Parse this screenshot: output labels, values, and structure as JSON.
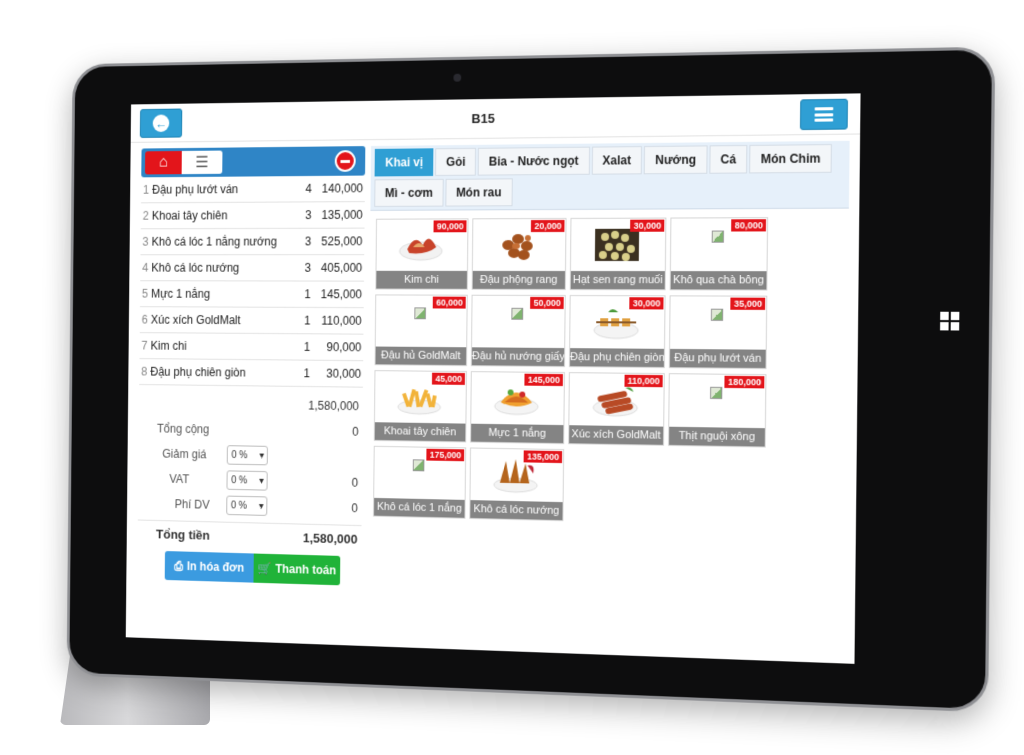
{
  "header": {
    "title": "B15"
  },
  "order": {
    "rows": [
      {
        "idx": "1",
        "name": "Đậu phụ lướt ván",
        "qty": "4",
        "price": "140,000"
      },
      {
        "idx": "2",
        "name": "Khoai tây chiên",
        "qty": "3",
        "price": "135,000"
      },
      {
        "idx": "3",
        "name": "Khô cá lóc 1 nắng nướng",
        "qty": "3",
        "price": "525,000"
      },
      {
        "idx": "4",
        "name": "Khô cá lóc nướng",
        "qty": "3",
        "price": "405,000"
      },
      {
        "idx": "5",
        "name": "Mực 1 nắng",
        "qty": "1",
        "price": "145,000"
      },
      {
        "idx": "6",
        "name": "Xúc xích GoldMalt",
        "qty": "1",
        "price": "110,000"
      },
      {
        "idx": "7",
        "name": "Kim chi",
        "qty": "1",
        "price": "90,000"
      },
      {
        "idx": "8",
        "name": "Đậu phụ chiên giòn",
        "qty": "1",
        "price": "30,000"
      }
    ],
    "subtotal": "1,580,000",
    "tong_cong_label": "Tổng cộng",
    "tong_cong_value": "0",
    "giam_gia_label": "Giảm giá",
    "giam_gia_select": "0 %",
    "vat_label": "VAT",
    "vat_select": "0 %",
    "vat_value": "0",
    "phi_dv_label": "Phí DV",
    "phi_dv_select": "0 %",
    "phi_dv_value": "0",
    "total_label": "Tổng tiền",
    "total_value": "1,580,000",
    "print_label": "In hóa đơn",
    "pay_label": "Thanh toán"
  },
  "menu": {
    "tabs_row1": [
      "Khai vị",
      "Gỏi",
      "Bia - Nước ngọt",
      "Xalat",
      "Nướng",
      "Cá",
      "Món Chim"
    ],
    "tabs_row2": [
      "Mì - cơm",
      "Món rau"
    ],
    "active_tab": "Khai vị",
    "items": [
      {
        "name": "Kim chi",
        "price": "90,000",
        "image": "kimchi"
      },
      {
        "name": "Đậu phộng rang",
        "price": "20,000",
        "image": "peanuts"
      },
      {
        "name": "Hạt sen rang muối",
        "price": "30,000",
        "image": "lotus-seeds"
      },
      {
        "name": "Khô qua chà bông",
        "price": "80,000",
        "image": "broken"
      },
      {
        "name": "Đậu hủ GoldMalt",
        "price": "60,000",
        "image": "broken"
      },
      {
        "name": "Đậu hủ nướng giấy",
        "price": "50,000",
        "image": "broken"
      },
      {
        "name": "Đậu phụ chiên giòn",
        "price": "30,000",
        "image": "skewers"
      },
      {
        "name": "Đậu phụ lướt ván",
        "price": "35,000",
        "image": "broken"
      },
      {
        "name": "Khoai tây chiên",
        "price": "45,000",
        "image": "fries"
      },
      {
        "name": "Mực 1 nắng",
        "price": "145,000",
        "image": "squid"
      },
      {
        "name": "Xúc xích GoldMalt",
        "price": "110,000",
        "image": "sausage"
      },
      {
        "name": "Thịt nguội xông",
        "price": "180,000",
        "image": "broken"
      },
      {
        "name": "Khô cá lóc 1 nắng",
        "price": "175,000",
        "image": "broken"
      },
      {
        "name": "Khô cá lóc nướng",
        "price": "135,000",
        "image": "dried-fish"
      }
    ]
  },
  "colors": {
    "primary": "#2f9fd4",
    "red": "#e3151b",
    "green": "#20b339",
    "header_blue": "#2f85c6"
  }
}
